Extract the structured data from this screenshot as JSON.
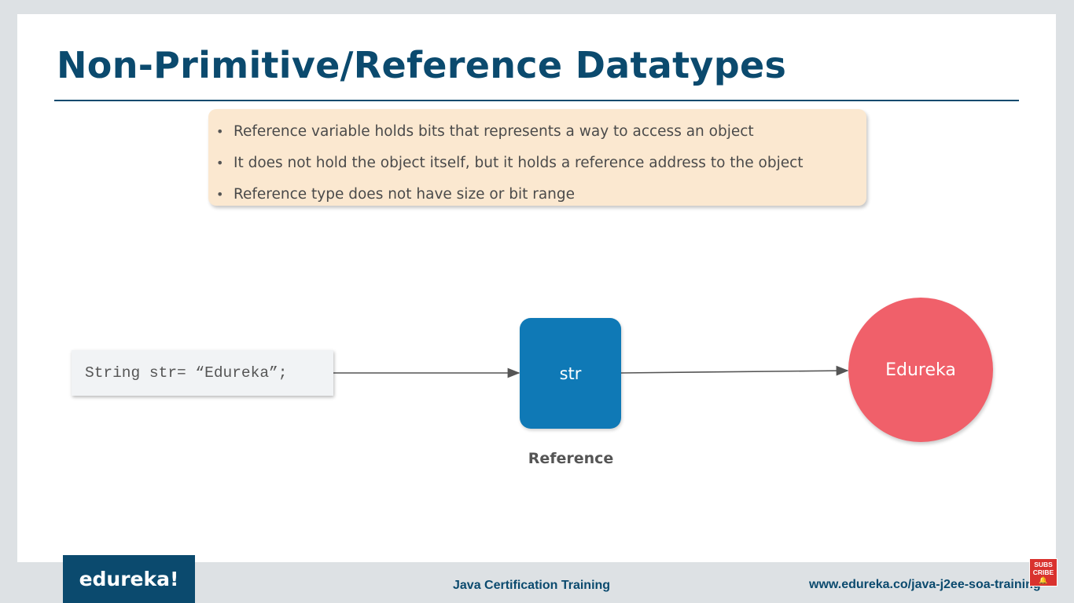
{
  "slide": {
    "title": "Non-Primitive/Reference Datatypes",
    "bullets": [
      "Reference variable holds bits that represents a way to access an object",
      "It does not hold the object itself, but it holds a reference address to the object",
      "Reference type does not have size or bit range"
    ],
    "bullet_symbol": "•",
    "diagram": {
      "code": "String str= “Edureka”;",
      "reference_box_text": "str",
      "reference_caption": "Reference",
      "object_text": "Edureka"
    }
  },
  "footer": {
    "logo": "edureka!",
    "course": "Java Certification Training",
    "url": "www.edureka.co/java-j2ee-soa-training",
    "subscribe_label_1": "SUBS",
    "subscribe_label_2": "CRIBE",
    "subscribe_icon": "bell-icon"
  },
  "colors": {
    "title_blue": "#0b4a6e",
    "bullet_background": "#fbe8d0",
    "reference_box": "#0f79b6",
    "object_circle": "#f0606a"
  }
}
